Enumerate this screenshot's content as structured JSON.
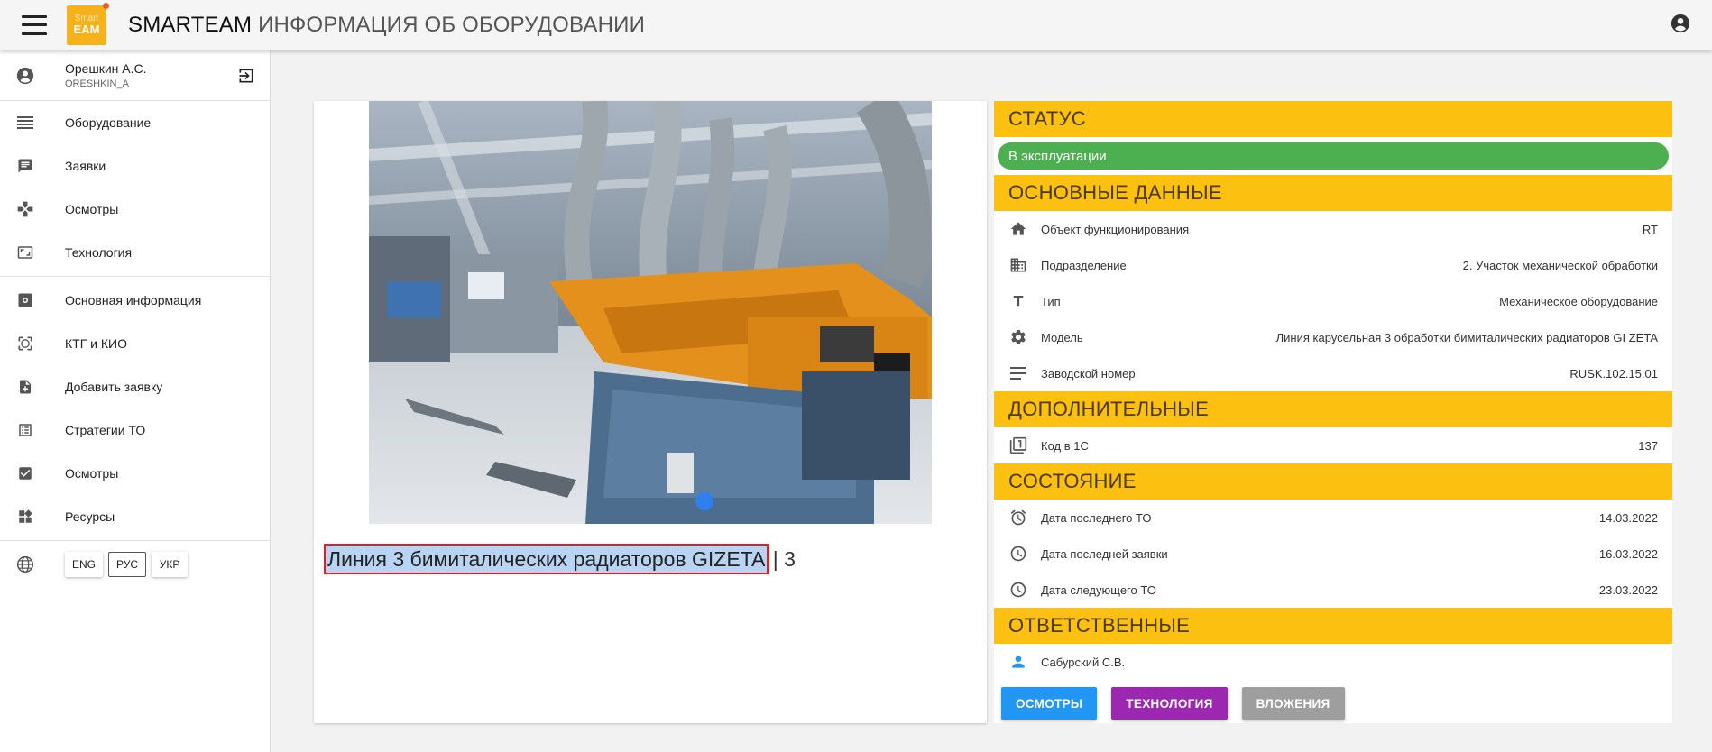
{
  "app": {
    "logo_line1": "Smart",
    "logo_line2": "EAM",
    "title_brand": "SMARTEAM",
    "title_page": "ИНФОРМАЦИЯ ОБ ОБОРУДОВАНИИ"
  },
  "user": {
    "name": "Орешкин А.С.",
    "login": "ORESHKIN_A"
  },
  "sidebar": {
    "group1": [
      {
        "label": "Оборудование",
        "icon": "list-icon"
      },
      {
        "label": "Заявки",
        "icon": "message-icon"
      },
      {
        "label": "Осмотры",
        "icon": "gamepad-icon"
      },
      {
        "label": "Технология",
        "icon": "aspect-ratio-icon"
      }
    ],
    "group2": [
      {
        "label": "Основная информация",
        "icon": "settings-box-icon"
      },
      {
        "label": "КТГ и КИО",
        "icon": "filter-center-icon"
      },
      {
        "label": "Добавить заявку",
        "icon": "note-add-icon"
      },
      {
        "label": "Стратегии ТО",
        "icon": "list-alt-icon"
      },
      {
        "label": "Осмотры",
        "icon": "check-box-icon"
      },
      {
        "label": "Ресурсы",
        "icon": "widgets-icon"
      }
    ],
    "languages": [
      "ENG",
      "РУС",
      "УКР"
    ],
    "active_language": "РУС"
  },
  "equipment": {
    "caption_selected": "Линия 3 бимиталических радиаторов GIZETA",
    "caption_rest": "| 3"
  },
  "panel": {
    "status_title": "СТАТУС",
    "status_value": "В эксплуатации",
    "status_color": "#4caf50",
    "main_title": "ОСНОВНЫЕ ДАННЫЕ",
    "main_rows": [
      {
        "key": "Объект функционирования",
        "value": "RT",
        "icon": "home-icon"
      },
      {
        "key": "Подразделение",
        "value": "2. Участок механической обработки",
        "icon": "building-icon"
      },
      {
        "key": "Тип",
        "value": "Механическое оборудование",
        "icon": "text-type-icon"
      },
      {
        "key": "Модель",
        "value": "Линия карусельная 3 обработки бимиталических радиаторов GI ZETA",
        "icon": "gear-icon"
      },
      {
        "key": "Заводской номер",
        "value": "RUSK.102.15.01",
        "icon": "lines-icon"
      }
    ],
    "extra_title": "ДОПОЛНИТЕЛЬНЫЕ",
    "extra_rows": [
      {
        "key": "Код в 1С",
        "value": "137",
        "icon": "filter-1-icon"
      }
    ],
    "state_title": "СОСТОЯНИЕ",
    "state_rows": [
      {
        "key": "Дата последнего ТО",
        "value": "14.03.2022",
        "icon": "alarm-icon"
      },
      {
        "key": "Дата последней заявки",
        "value": "16.03.2022",
        "icon": "clock-icon"
      },
      {
        "key": "Дата следующего ТО",
        "value": "23.03.2022",
        "icon": "clock-icon"
      }
    ],
    "resp_title": "ОТВЕТСТВЕННЫЕ",
    "resp_rows": [
      {
        "key": "Сабурский С.В.",
        "value": "",
        "icon": "person-icon"
      }
    ],
    "buttons": {
      "inspections": "ОСМОТРЫ",
      "technology": "ТЕХНОЛОГИЯ",
      "attachments": "ВЛОЖЕНИЯ"
    }
  },
  "colors": {
    "accent": "#fcc010",
    "btn_inspections": "#2196f3",
    "btn_technology": "#9c27b0",
    "btn_attachments": "#9e9e9e"
  }
}
